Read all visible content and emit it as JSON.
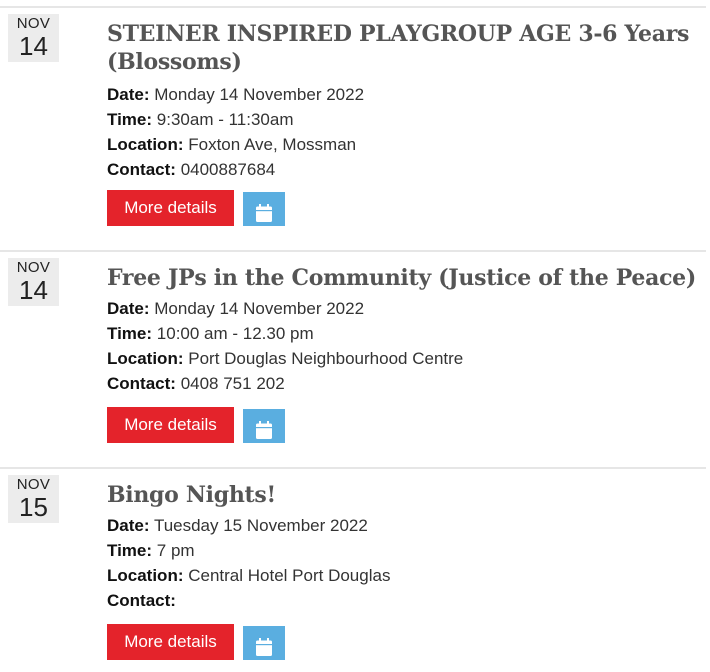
{
  "labels": {
    "date": "Date:",
    "time": "Time:",
    "location": "Location:",
    "contact": "Contact:"
  },
  "events": [
    {
      "month": "NOV",
      "day": "14",
      "title": "STEINER INSPIRED PLAYGROUP AGE 3-6 Years (Blossoms)",
      "date": "Monday 14 November 2022",
      "time": "9:30am - 11:30am",
      "location": "Foxton Ave, Mossman",
      "contact": "0400887684",
      "more_label": "More details",
      "calendar_icon": "calendar-icon"
    },
    {
      "month": "NOV",
      "day": "14",
      "title": "Free JPs in the Community (Justice of the Peace)",
      "date": "Monday 14 November 2022",
      "time": "10:00 am - 12.30 pm",
      "location": "Port Douglas Neighbourhood Centre",
      "contact": "0408 751 202",
      "more_label": "More details",
      "calendar_icon": "calendar-icon"
    },
    {
      "month": "NOV",
      "day": "15",
      "title": "Bingo Nights!",
      "date": "Tuesday 15 November 2022",
      "time": "7 pm",
      "location": "Central Hotel Port Douglas",
      "contact": "",
      "more_label": "More details",
      "calendar_icon": "calendar-icon"
    }
  ],
  "colors": {
    "more_button": "#e4232b",
    "calendar_button": "#5aaee0",
    "date_box": "#ececec",
    "title": "#555555"
  }
}
